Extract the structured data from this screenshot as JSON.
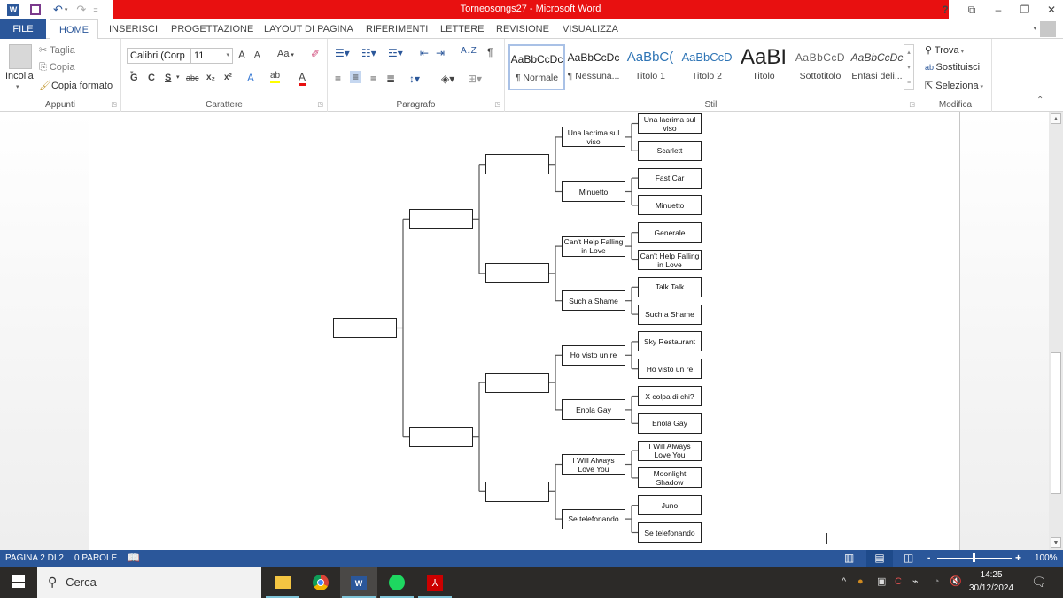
{
  "window": {
    "title": "Torneosongs27 -  Microsoft Word",
    "controls": [
      "?",
      "ribbon-display",
      "minimize",
      "restore",
      "close"
    ]
  },
  "qat": {
    "word_icon": "W",
    "save_icon": "save",
    "undo_icon": "↶",
    "redo_icon": "↷",
    "customize_icon": "="
  },
  "tabs": [
    {
      "label": "FILE"
    },
    {
      "label": "HOME"
    },
    {
      "label": "INSERISCI"
    },
    {
      "label": "PROGETTAZIONE"
    },
    {
      "label": "LAYOUT DI PAGINA"
    },
    {
      "label": "RIFERIMENTI"
    },
    {
      "label": "LETTERE"
    },
    {
      "label": "REVISIONE"
    },
    {
      "label": "VISUALIZZA"
    }
  ],
  "ribbon": {
    "appunti": {
      "label": "Appunti",
      "paste": "Incolla",
      "cut": "Taglia",
      "copy": "Copia",
      "format_painter": "Copia formato"
    },
    "carattere": {
      "label": "Carattere",
      "font_name": "Calibri (Corp",
      "font_size": "11",
      "grow": "A",
      "shrink": "A",
      "case": "Aa",
      "bold": "G",
      "italic": "C",
      "underline": "S",
      "strike": "abc",
      "subscript": "x₂",
      "superscript": "x²",
      "effects": "A",
      "highlight": "ab",
      "font_color": "A",
      "highlight_color": "#ffff00",
      "font_color_value": "#e81010"
    },
    "paragrafo": {
      "label": "Paragrafo",
      "sort": "A↓Z",
      "pilcrow": "¶"
    },
    "stili": {
      "label": "Stili",
      "items": [
        {
          "sample": "AaBbCcDc",
          "name": "¶ Normale",
          "selected": true
        },
        {
          "sample": "AaBbCcDc",
          "name": "¶ Nessuna..."
        },
        {
          "sample": "AaBbC(",
          "name": "Titolo 1"
        },
        {
          "sample": "AaBbCcD",
          "name": "Titolo 2"
        },
        {
          "sample": "AaBI",
          "name": "Titolo"
        },
        {
          "sample": "AaBbCcD",
          "name": "Sottotitolo"
        },
        {
          "sample": "AaBbCcDc",
          "name": "Enfasi deli..."
        }
      ]
    },
    "modifica": {
      "label": "Modifica",
      "find": "Trova",
      "replace": "Sostituisci",
      "select": "Seleziona"
    }
  },
  "bracket": {
    "final": [
      ""
    ],
    "semifinal": [
      "",
      ""
    ],
    "quarterfinal": [
      "",
      "",
      "",
      ""
    ],
    "round_of_16": [
      "Una lacrima sul viso",
      "Minuetto",
      "Can't Help Falling in Love",
      "Such a Shame",
      "Ho visto un re",
      "Enola Gay",
      "I Will Always Love You",
      "Se telefonando"
    ],
    "round_of_32": [
      "Una lacrima sul viso",
      "Scarlett",
      "Fast Car",
      "Minuetto",
      "Generale",
      "Can't Help Falling in Love",
      "Talk Talk",
      "Such a Shame",
      "Sky Restaurant",
      "Ho visto un re",
      "X colpa di chi?",
      "Enola Gay",
      "I Will Always Love You",
      "Moonlight Shadow",
      "Juno",
      "Se telefonando"
    ]
  },
  "status": {
    "page": "PAGINA 2 DI 2",
    "words": "0 PAROLE",
    "zoom": "100%",
    "zoom_minus": "-",
    "zoom_plus": "+",
    "zoom_level_percent": 100
  },
  "taskbar": {
    "search_placeholder": "Cerca",
    "apps": [
      "file-explorer",
      "chrome",
      "word",
      "spotify",
      "acrobat"
    ],
    "time": "14:25",
    "date": "30/12/2024"
  }
}
